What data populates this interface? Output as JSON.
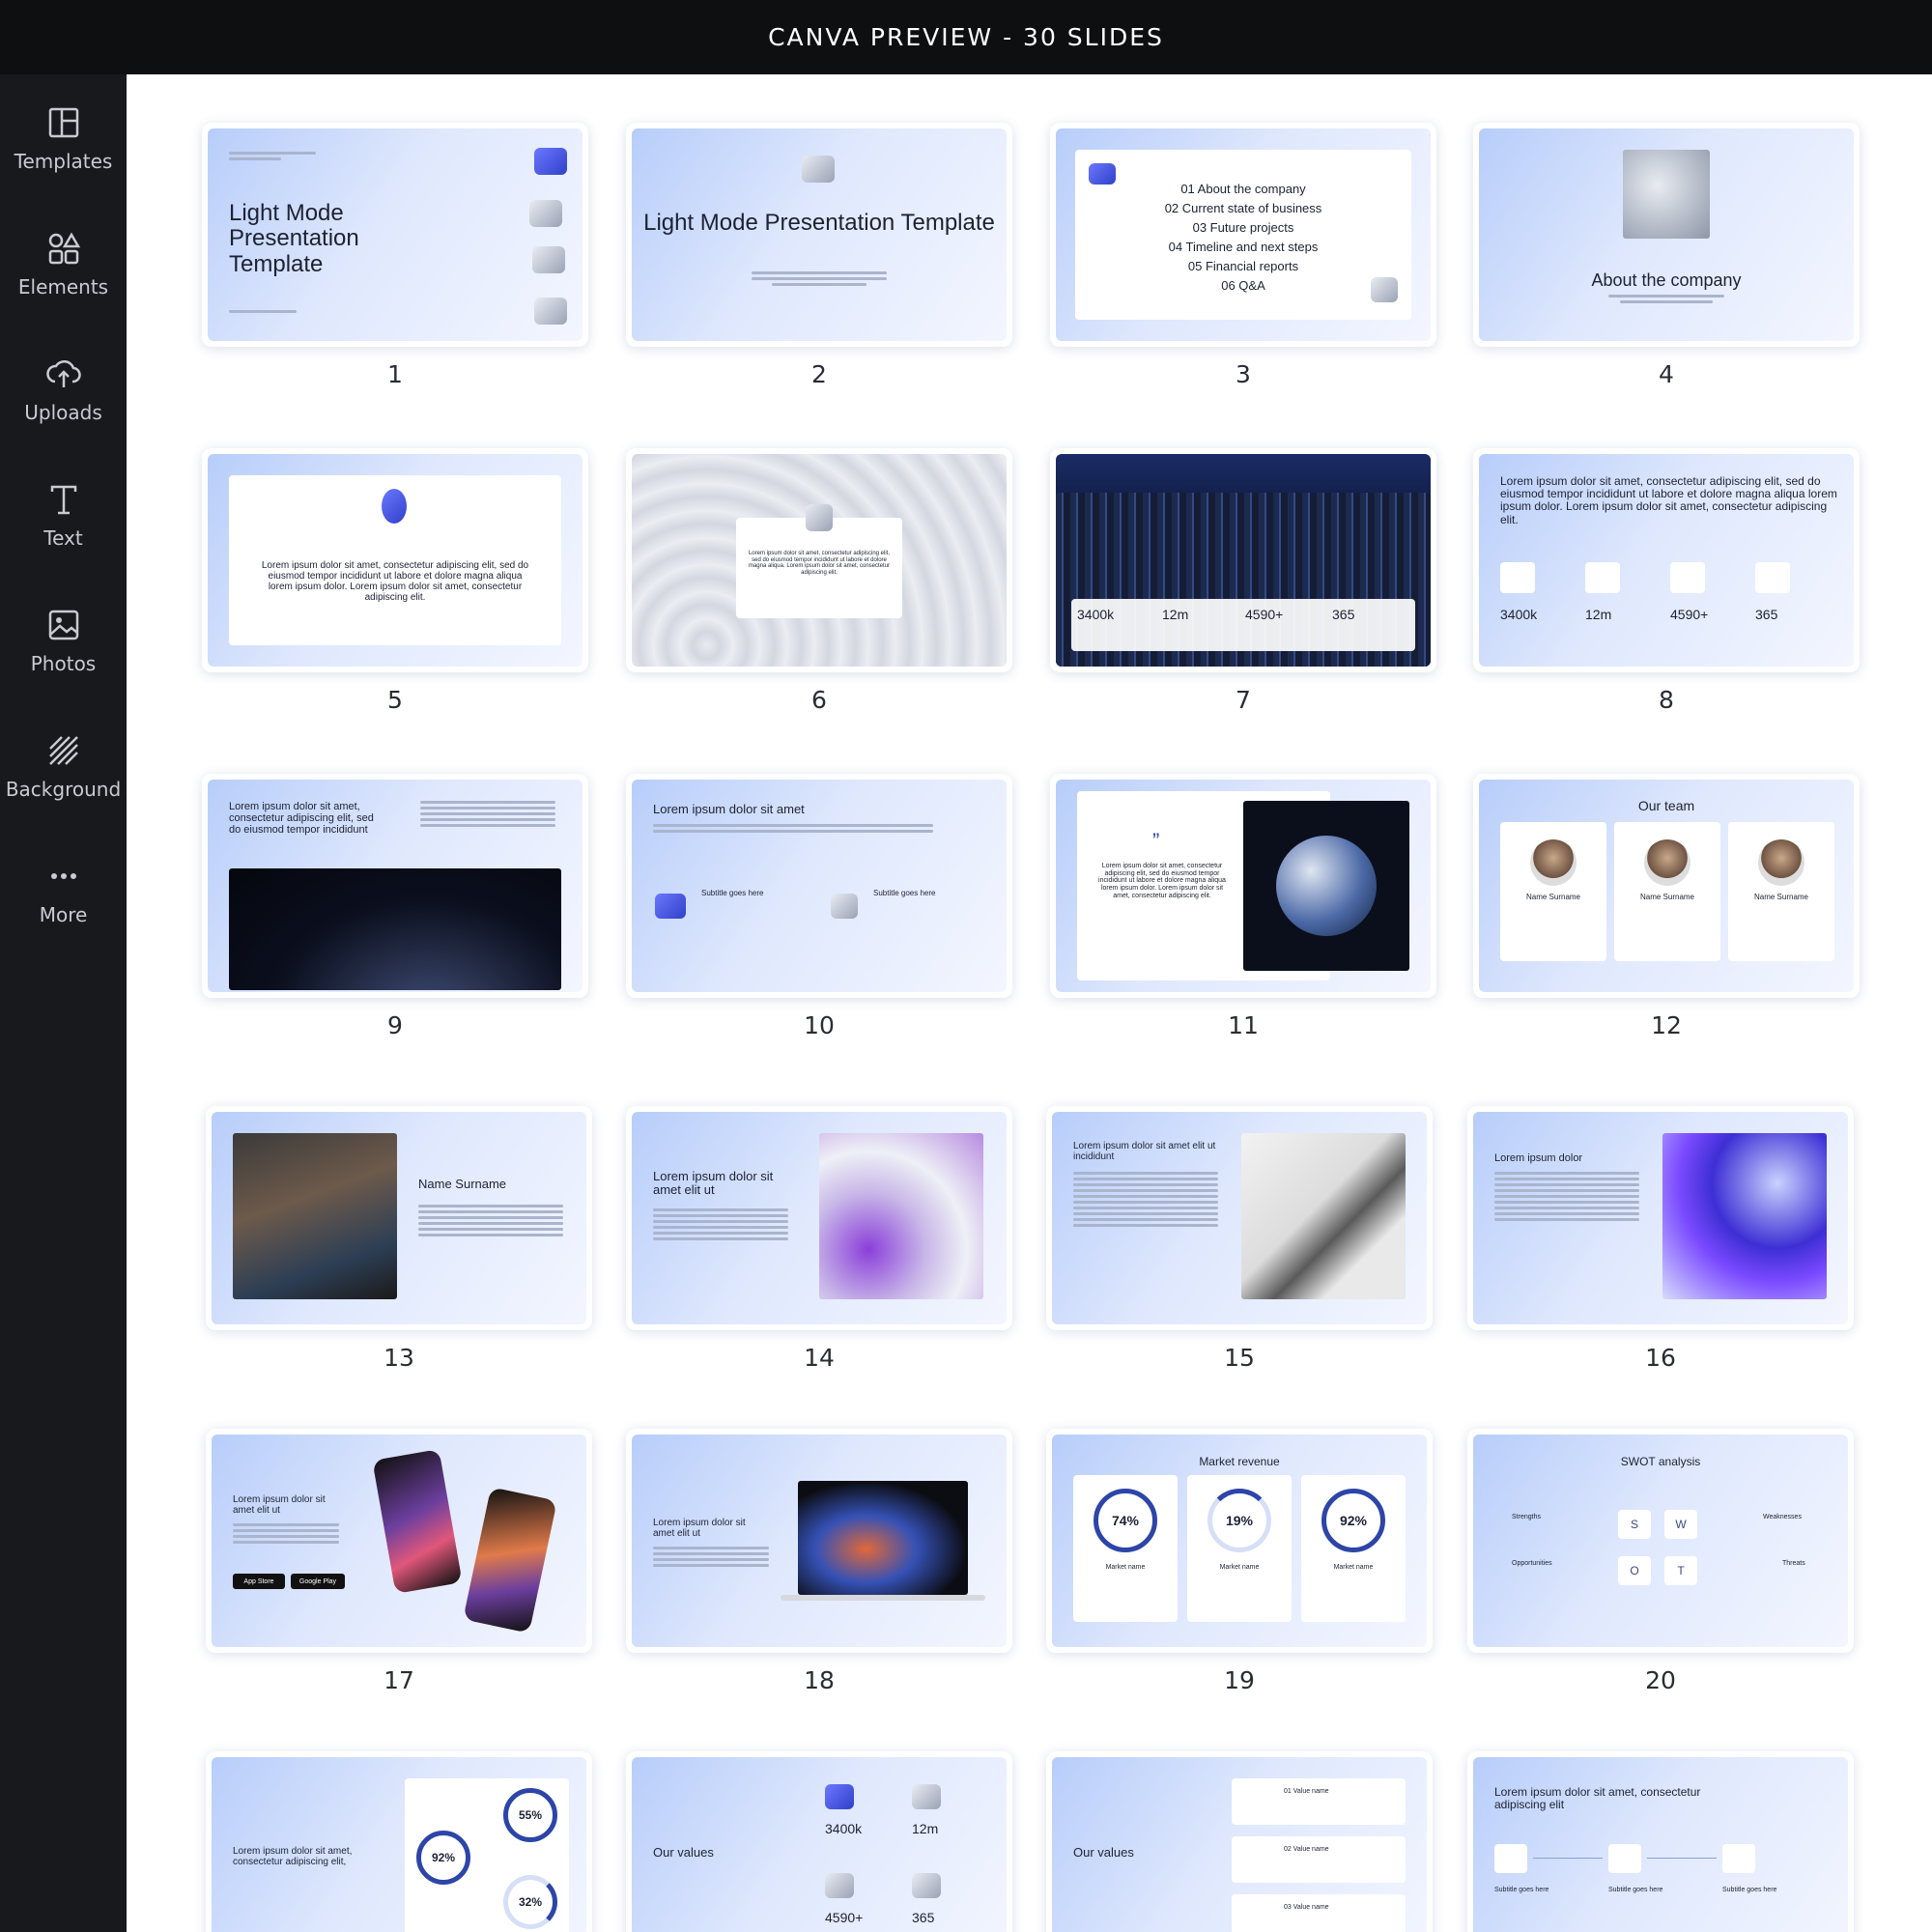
{
  "header": {
    "title": "CANVA PREVIEW - 30 SLIDES"
  },
  "sidebar": {
    "items": [
      {
        "label": "Templates",
        "icon": "templates-icon"
      },
      {
        "label": "Elements",
        "icon": "elements-icon"
      },
      {
        "label": "Uploads",
        "icon": "uploads-icon"
      },
      {
        "label": "Text",
        "icon": "text-icon"
      },
      {
        "label": "Photos",
        "icon": "photos-icon"
      },
      {
        "label": "Background",
        "icon": "background-icon"
      },
      {
        "label": "More",
        "icon": "more-icon"
      }
    ]
  },
  "slides": {
    "numbers": [
      "1",
      "2",
      "3",
      "4",
      "5",
      "6",
      "7",
      "8",
      "9",
      "10",
      "11",
      "12",
      "13",
      "14",
      "15",
      "16",
      "17",
      "18",
      "19",
      "20"
    ],
    "s1": {
      "title": "Light Mode Presentation Template"
    },
    "s2": {
      "title": "Light Mode Presentation Template"
    },
    "s3": {
      "agenda": [
        "01 About the company",
        "02 Current state of business",
        "03 Future projects",
        "04 Timeline and next steps",
        "05 Financial reports",
        "06 Q&A"
      ]
    },
    "s4": {
      "title": "About the company"
    },
    "s5": {
      "body": "Lorem ipsum dolor sit amet, consectetur adipiscing elit, sed do eiusmod tempor incididunt ut labore et dolore magna aliqua lorem ipsum dolor. Lorem ipsum dolor sit amet, consectetur adipiscing elit."
    },
    "s6": {
      "body": "Lorem ipsum dolor sit amet, consectetur adipiscing elit, sed do eiusmod tempor incididunt ut labore et dolore magna aliqua. Lorem ipsum dolor sit amet, consectetur adipiscing elit."
    },
    "s7": {
      "stats": [
        "3400k",
        "12m",
        "4590+",
        "365"
      ]
    },
    "s8": {
      "heading": "Lorem ipsum dolor sit amet, consectetur adipiscing elit, sed do eiusmod tempor incididunt ut labore et dolore magna aliqua lorem ipsum dolor. Lorem ipsum dolor sit amet, consectetur adipiscing elit.",
      "stats": [
        "3400k",
        "12m",
        "4590+",
        "365"
      ]
    },
    "s9": {
      "heading": "Lorem ipsum dolor sit amet, consectetur adipiscing elit, sed do eiusmod tempor incididunt"
    },
    "s10": {
      "heading": "Lorem ipsum dolor sit amet",
      "sub1": "Subtitle goes here",
      "sub2": "Subtitle goes here"
    },
    "s11": {
      "quote": "Lorem ipsum dolor sit amet, consectetur adipiscing elit, sed do eiusmod tempor incididunt ut labore et dolore magna aliqua lorem ipsum dolor. Lorem ipsum dolor sit amet, consectetur adipiscing elit."
    },
    "s12": {
      "title": "Our team",
      "names": [
        "Name Surname",
        "Name Surname",
        "Name Surname"
      ]
    },
    "s13": {
      "name": "Name Surname"
    },
    "s14": {
      "heading": "Lorem ipsum dolor sit amet elit ut"
    },
    "s15": {
      "heading": "Lorem ipsum dolor sit amet elit ut incididunt"
    },
    "s16": {
      "heading": "Lorem ipsum dolor"
    },
    "s17": {
      "heading": "Lorem ipsum dolor sit amet elit ut",
      "store1": "App Store",
      "store2": "Google Play"
    },
    "s18": {
      "heading": "Lorem ipsum dolor sit amet elit ut"
    },
    "s19": {
      "title": "Market revenue",
      "values": [
        "74%",
        "19%",
        "92%"
      ],
      "label": "Market name"
    },
    "s20": {
      "title": "SWOT analysis",
      "letters": [
        "S",
        "W",
        "O",
        "T"
      ],
      "labels": [
        "Strengths",
        "Weaknesses",
        "Opportunities",
        "Threats"
      ]
    },
    "s21": {
      "heading": "Lorem ipsum dolor sit amet, consectetur adipiscing elit,",
      "values": [
        "55%",
        "92%",
        "32%"
      ]
    },
    "s22": {
      "heading": "Our values",
      "stats": [
        "3400k",
        "12m",
        "4590+",
        "365"
      ]
    },
    "s23": {
      "heading": "Our values",
      "items": [
        "01 Value name",
        "02 Value name",
        "03 Value name"
      ]
    },
    "s24": {
      "heading": "Lorem ipsum dolor sit amet, consectetur adipiscing elit",
      "sub": "Subtitle goes here"
    }
  },
  "colors": {
    "accent": "#2d45a8",
    "sidebar_bg": "#17191c",
    "topbar_bg": "#0e0f11"
  }
}
